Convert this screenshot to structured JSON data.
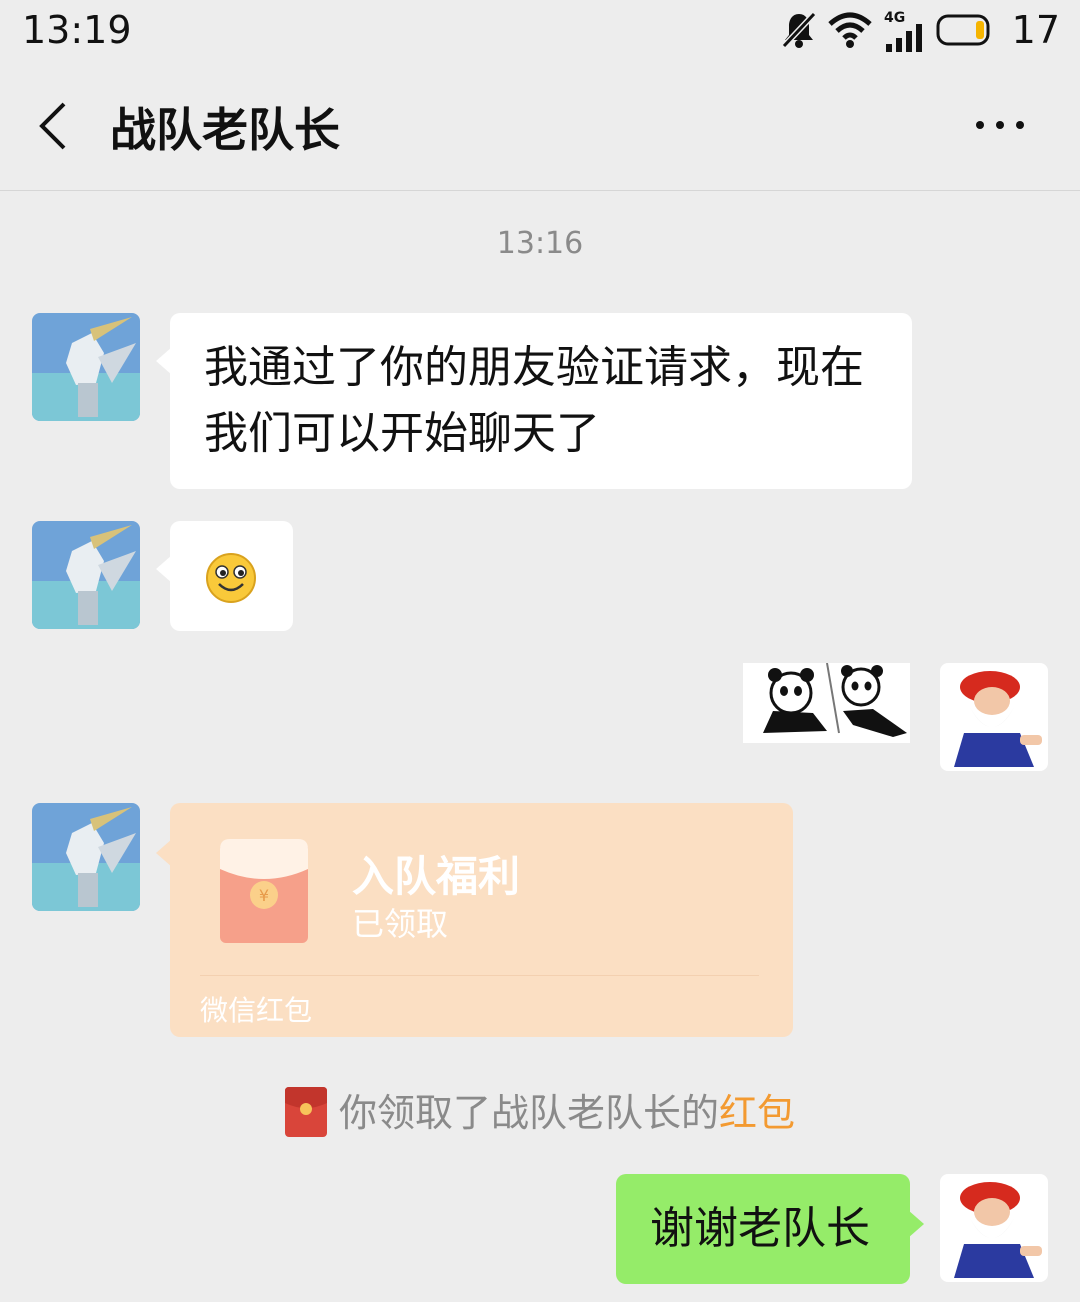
{
  "status_bar": {
    "time": "13:19",
    "network": "4G",
    "battery_level": "17",
    "icons": [
      "mute-icon",
      "wifi-icon",
      "signal-icon",
      "battery-icon"
    ]
  },
  "header": {
    "title": "战队老队长",
    "back_icon": "back-arrow-icon",
    "more_icon": "more-dots-icon"
  },
  "chat": {
    "timestamp": "13:16",
    "messages": [
      {
        "side": "left",
        "type": "text",
        "text": "我通过了你的朋友验证请求，现在我们可以开始聊天了"
      },
      {
        "side": "left",
        "type": "emoji",
        "icon": "smile-emoji-icon"
      },
      {
        "side": "right",
        "type": "sticker",
        "icon": "panda-sticker-icon"
      },
      {
        "side": "left",
        "type": "red_packet",
        "title": "入队福利",
        "status": "已领取",
        "label": "微信红包"
      },
      {
        "side": "system",
        "type": "notice",
        "text": "你领取了战队老队长的",
        "link": "红包"
      },
      {
        "side": "right",
        "type": "text",
        "text": "谢谢老队长"
      }
    ]
  },
  "colors": {
    "background": "#ededed",
    "bubble_self": "#95ec69",
    "bubble_other": "#ffffff",
    "red_packet": "#fbdfc3",
    "link": "#f39a31"
  }
}
